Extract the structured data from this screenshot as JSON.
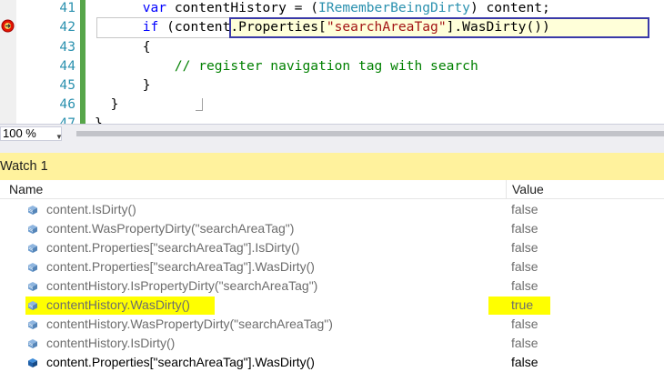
{
  "editor": {
    "lines": [
      {
        "num": "41",
        "indent": "      ",
        "tokens": [
          [
            "kw",
            "var"
          ],
          [
            "",
            " contentHistory = ("
          ],
          [
            "ty",
            "IRememberBeingDirty"
          ],
          [
            "",
            ") content;"
          ]
        ]
      },
      {
        "num": "42",
        "indent": "      ",
        "tokens": [
          [
            "kw",
            "if"
          ],
          [
            "",
            " (content.Properties["
          ],
          [
            "str",
            "\"searchAreaTag\""
          ],
          [
            "",
            "].WasDirty())"
          ]
        ]
      },
      {
        "num": "43",
        "indent": "      ",
        "tokens": [
          [
            "",
            "{"
          ]
        ]
      },
      {
        "num": "44",
        "indent": "          ",
        "tokens": [
          [
            "cm",
            "// register navigation tag with search"
          ]
        ]
      },
      {
        "num": "45",
        "indent": "      ",
        "tokens": [
          [
            "",
            "}"
          ]
        ]
      },
      {
        "num": "46",
        "indent": "  ",
        "tokens": [
          [
            "",
            "}"
          ]
        ]
      },
      {
        "num": "47",
        "indent": "",
        "tokens": [
          [
            "",
            "}"
          ]
        ]
      }
    ]
  },
  "zoom": {
    "value": "100 %"
  },
  "watch": {
    "title": "Watch 1",
    "columns": {
      "name": "Name",
      "value": "Value"
    },
    "rows": [
      {
        "name": "content.IsDirty()",
        "value": "false",
        "highlight": false,
        "active": false
      },
      {
        "name": "content.WasPropertyDirty(\"searchAreaTag\")",
        "value": "false",
        "highlight": false,
        "active": false
      },
      {
        "name": "content.Properties[\"searchAreaTag\"].IsDirty()",
        "value": "false",
        "highlight": false,
        "active": false
      },
      {
        "name": "content.Properties[\"searchAreaTag\"].WasDirty()",
        "value": "false",
        "highlight": false,
        "active": false
      },
      {
        "name": "contentHistory.IsPropertyDirty(\"searchAreaTag\")",
        "value": "false",
        "highlight": false,
        "active": false
      },
      {
        "name": "contentHistory.WasDirty()",
        "value": "true",
        "highlight": true,
        "active": false
      },
      {
        "name": "contentHistory.WasPropertyDirty(\"searchAreaTag\")",
        "value": "false",
        "highlight": false,
        "active": false
      },
      {
        "name": "contentHistory.IsDirty()",
        "value": "false",
        "highlight": false,
        "active": false
      },
      {
        "name": "content.Properties[\"searchAreaTag\"].WasDirty()",
        "value": "false",
        "highlight": false,
        "active": true
      }
    ]
  },
  "colors": {
    "highlight": "#ffff00",
    "watch_title_bg": "#fff29d",
    "line_number": "#2b91af",
    "keyword": "#0000ff",
    "string": "#a31515",
    "comment": "#008000",
    "change_bar": "#57a64a"
  },
  "icons": {
    "breakpoint": "breakpoint-current-statement-icon",
    "watch_item": "watch-item-cube-icon"
  }
}
